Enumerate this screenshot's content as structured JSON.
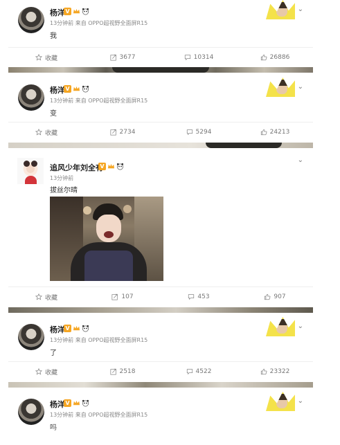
{
  "posts": [
    {
      "author": "杨洋",
      "meta": "13分钟前 来自 OPPO超视野全面屏R15",
      "text": "我",
      "favorite_label": "收藏",
      "repost_count": "3677",
      "comment_count": "10314",
      "like_count": "26886"
    },
    {
      "author": "杨洋",
      "meta": "13分钟前 来自 OPPO超视野全面屏R15",
      "text": "变",
      "favorite_label": "收藏",
      "repost_count": "2734",
      "comment_count": "5294",
      "like_count": "24213"
    },
    {
      "author": "追风少年刘全有",
      "meta": "13分钟前",
      "text": "拔丝尔晴",
      "favorite_label": "收藏",
      "repost_count": "107",
      "comment_count": "453",
      "like_count": "907"
    },
    {
      "author": "杨洋",
      "meta": "13分钟前 来自 OPPO超视野全面屏R15",
      "text": "了",
      "favorite_label": "收藏",
      "repost_count": "2518",
      "comment_count": "4522",
      "like_count": "23322"
    },
    {
      "author": "杨洋",
      "meta": "13分钟前 来自 OPPO超视野全面屏R15",
      "text": "吗"
    }
  ],
  "badges": {
    "verified": "V"
  },
  "colors": {
    "verified": "#f5a623",
    "fan_badge": "#f4e24a"
  }
}
